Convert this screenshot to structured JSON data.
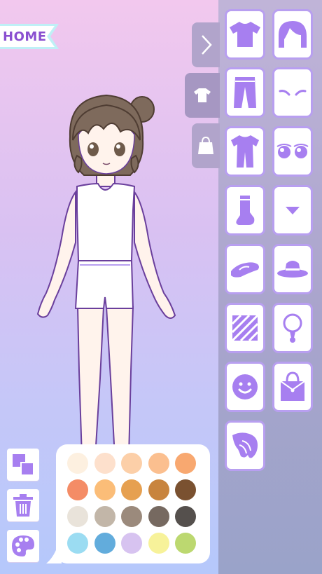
{
  "home": {
    "label": "HOME"
  },
  "colors": {
    "accent": "#a77ff0",
    "accent_dark": "#8a4fd0",
    "card_border": "#b89ff0"
  },
  "side_tabs": [
    {
      "name": "chevron-right-icon",
      "active": false
    },
    {
      "name": "tshirt-icon",
      "active": true
    },
    {
      "name": "shopping-bag-icon",
      "active": false
    }
  ],
  "categories": [
    "tshirt-top-icon",
    "hair-icon",
    "pants-icon",
    "eyebrows-icon",
    "jumpsuit-icon",
    "eyes-icon",
    "sock-icon",
    "mouth-icon",
    "shoe-icon",
    "hat-icon",
    "pattern-icon",
    "necklace-icon",
    "face-icon",
    "handbag-icon",
    "wing-icon"
  ],
  "tools": [
    "layers-icon",
    "trash-icon",
    "palette-icon"
  ],
  "palette_swatches": [
    "#fdf0e0",
    "#fde0cc",
    "#fccfa8",
    "#fbbf8f",
    "#f8a870",
    "#f48c66",
    "#fbbd78",
    "#e6a050",
    "#c8843e",
    "#7a5130",
    "#e9e3da",
    "#c2b6a8",
    "#9b8a7c",
    "#766960",
    "#55504d",
    "#9bdcf2",
    "#62acdc",
    "#d7c3f0",
    "#f7f29a",
    "#bcd870"
  ]
}
